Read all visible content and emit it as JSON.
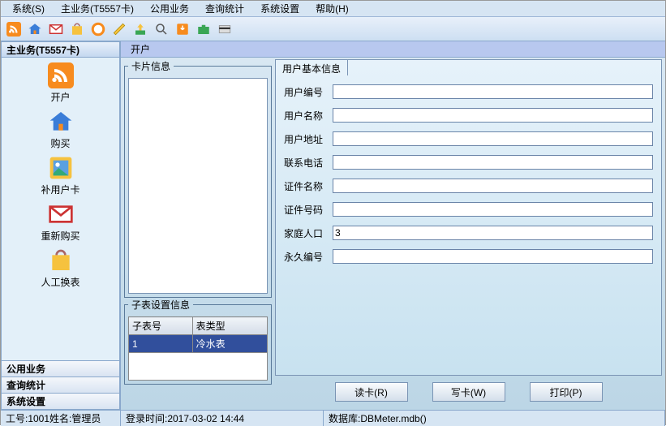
{
  "menu": {
    "items": [
      "系统(S)",
      "主业务(T5557卡)",
      "公用业务",
      "查询统计",
      "系统设置",
      "帮助(H)"
    ]
  },
  "sidebar": {
    "header": "主业务(T5557卡)",
    "items": [
      {
        "label": "开户"
      },
      {
        "label": "购买"
      },
      {
        "label": "补用户卡"
      },
      {
        "label": "重新购买"
      },
      {
        "label": "人工换表"
      }
    ],
    "footer": [
      "公用业务",
      "查询统计",
      "系统设置"
    ]
  },
  "page": {
    "title": "开户",
    "card_group": "卡片信息",
    "sub_group": "子表设置信息",
    "sub_headers": [
      "子表号",
      "表类型"
    ],
    "sub_rows": [
      {
        "no": "1",
        "type": "冷水表"
      }
    ],
    "tab": "用户基本信息",
    "fields": [
      {
        "label": "用户编号",
        "value": ""
      },
      {
        "label": "用户名称",
        "value": ""
      },
      {
        "label": "用户地址",
        "value": ""
      },
      {
        "label": "联系电话",
        "value": ""
      },
      {
        "label": "证件名称",
        "value": ""
      },
      {
        "label": "证件号码",
        "value": ""
      },
      {
        "label": "家庭人口",
        "value": "3"
      },
      {
        "label": "永久编号",
        "value": ""
      }
    ],
    "buttons": {
      "read": "读卡(R)",
      "write": "写卡(W)",
      "print": "打印(P)"
    }
  },
  "status": {
    "user": "工号:1001姓名:管理员",
    "login": "登录时间:2017-03-02 14:44",
    "db": "数据库:DBMeter.mdb()"
  }
}
